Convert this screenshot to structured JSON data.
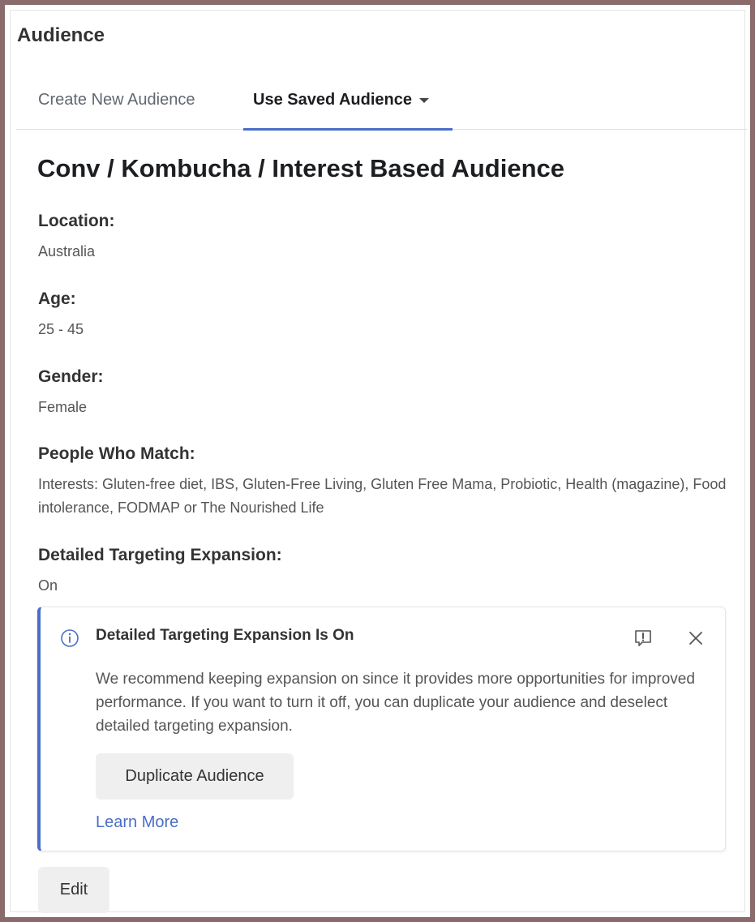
{
  "section": {
    "title": "Audience"
  },
  "tabs": [
    {
      "label": "Create New Audience",
      "active": false
    },
    {
      "label": "Use Saved Audience",
      "active": true,
      "has_dropdown": true
    }
  ],
  "audience": {
    "name": "Conv / Kombucha / Interest Based Audience",
    "fields": {
      "location": {
        "label": "Location:",
        "value": "Australia"
      },
      "age": {
        "label": "Age:",
        "value": "25 - 45"
      },
      "gender": {
        "label": "Gender:",
        "value": "Female"
      },
      "people_who_match": {
        "label": "People Who Match:",
        "value": "Interests: Gluten-free diet, IBS, Gluten-Free Living, Gluten Free Mama, Probiotic, Health (magazine), Food intolerance, FODMAP or The Nourished Life"
      },
      "detailed_targeting_expansion": {
        "label": "Detailed Targeting Expansion:",
        "value": "On"
      }
    }
  },
  "notice": {
    "icon": "info-icon",
    "title": "Detailed Targeting Expansion Is On",
    "body": "We recommend keeping expansion on since it provides more opportunities for improved performance. If you want to turn it off, you can duplicate your audience and deselect detailed targeting expansion.",
    "primary_button": "Duplicate Audience",
    "link": "Learn More",
    "report_icon": "report-icon",
    "close_icon": "close-icon"
  },
  "actions": {
    "edit_label": "Edit"
  },
  "colors": {
    "accent": "#4a6ec8",
    "frame": "#8a6a6a",
    "button_bg": "#efefef"
  }
}
